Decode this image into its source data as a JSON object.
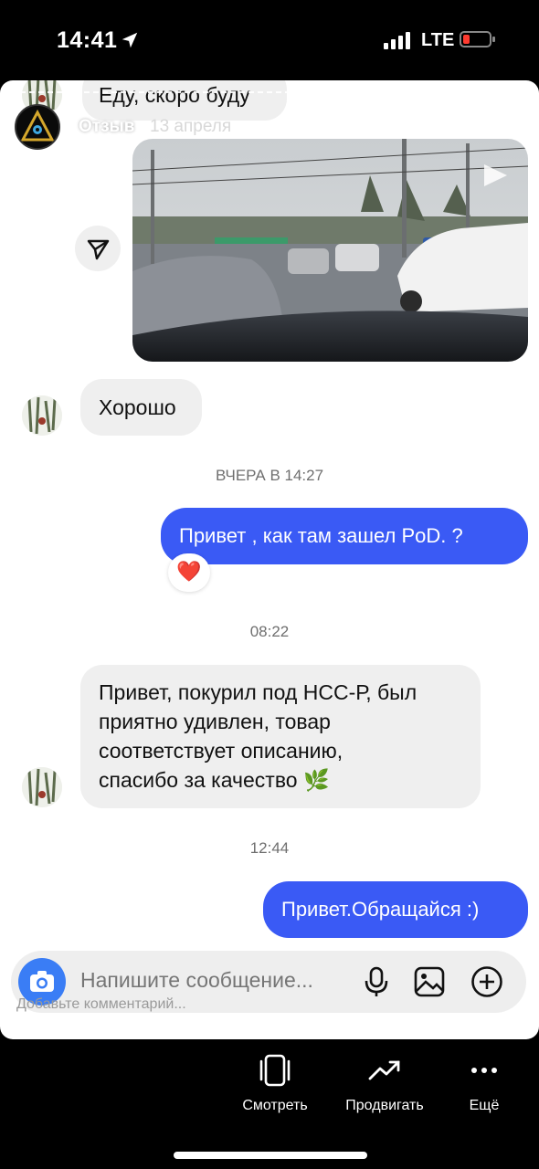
{
  "status_bar": {
    "time": "14:41",
    "network": "LTE",
    "icons": [
      "location-arrow-icon",
      "signal-icon",
      "battery-low-icon"
    ],
    "battery_color": "#ff3b30"
  },
  "story": {
    "user": "Отзыв",
    "date": "13 апреля"
  },
  "chat": {
    "top_message": "Еду, скоро буду",
    "reply_1": "Хорошо",
    "timestamp_1": "ВЧЕРА В 14:27",
    "sent_1": "Привет , как там зашел PoD.  ?",
    "reaction": "❤️",
    "timestamp_2": "08:22",
    "reply_2_lines": [
      "Привет, покурил под НСС-Р, был",
      "приятно удивлен, товар",
      "соответствует описанию,",
      "спасибо за качество 🌿"
    ],
    "timestamp_3": "12:44",
    "sent_2": "Привет.Обращайся :)"
  },
  "composer": {
    "placeholder": "Напишите сообщение...",
    "icons": [
      "camera-icon",
      "microphone-icon",
      "gallery-icon",
      "plus-icon"
    ]
  },
  "comment_hint": "Добавьте комментарий...",
  "bottom_nav": [
    {
      "label": "Смотреть",
      "icon": "view-icon"
    },
    {
      "label": "Продвигать",
      "icon": "trend-up-icon"
    },
    {
      "label": "Ещё",
      "icon": "more-icon"
    }
  ],
  "colors": {
    "outgoing_bubble": "#3a5af5",
    "incoming_bubble": "#efefef",
    "accent_camera": "#3a7df5"
  }
}
